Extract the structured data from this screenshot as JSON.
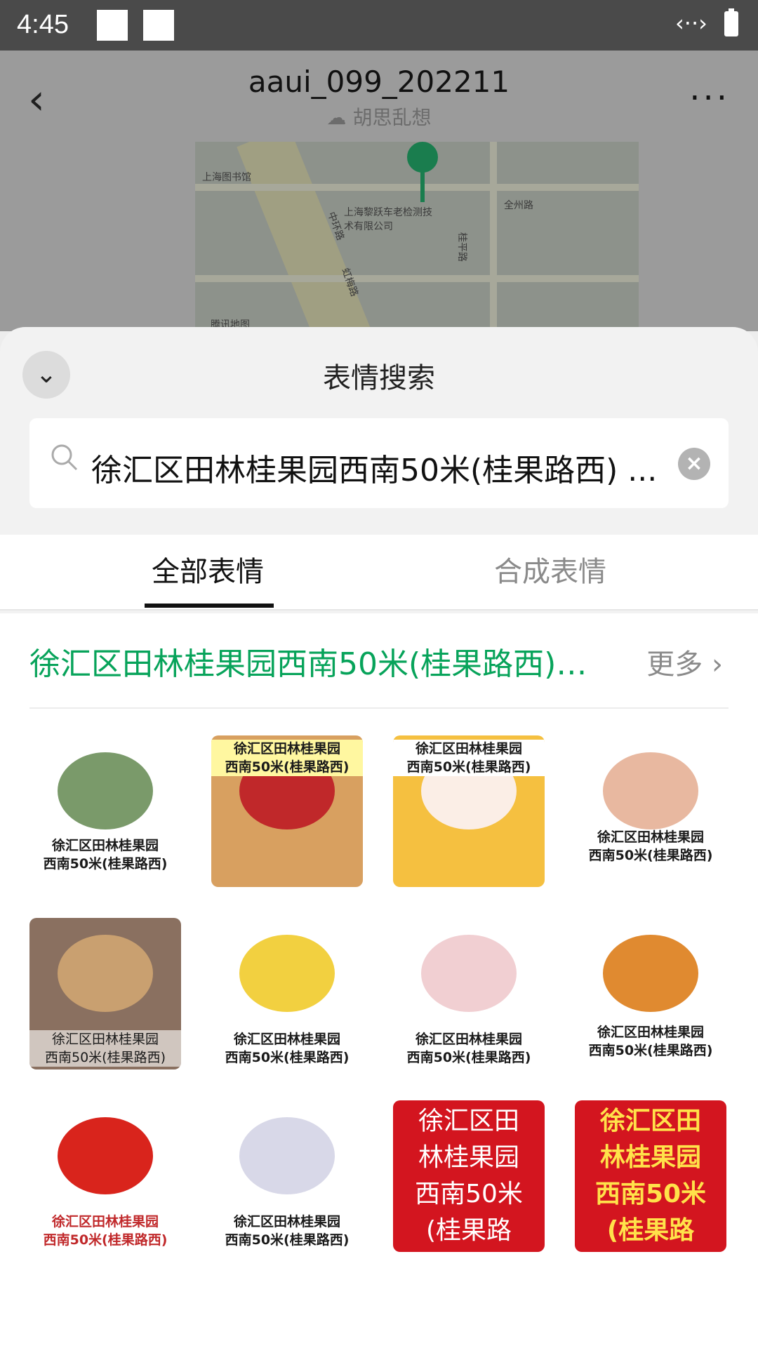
{
  "status_bar": {
    "time": "4:45"
  },
  "chat": {
    "title": "aaui_099_202211",
    "subtitle": "胡思乱想",
    "map_labels": [
      "上海图书馆",
      "上海黎跃车老检测技术有限公司",
      "腾讯地图",
      "中环路",
      "虹梅路",
      "桂平路",
      "全州路"
    ]
  },
  "sheet": {
    "title": "表情搜索",
    "search_query": "徐汇区田林桂果园西南50米(桂果路西) ...",
    "tabs": [
      {
        "label": "全部表情",
        "active": true
      },
      {
        "label": "合成表情",
        "active": false
      }
    ]
  },
  "results": {
    "heading": "徐汇区田林桂果园西南50米(桂果路西) ...",
    "more_label": "更多",
    "stickers": [
      {
        "caption": "徐汇区田林桂果园\n西南50米(桂果路西)",
        "style": "white-bg"
      },
      {
        "caption": "徐汇区田林桂果园\n西南50米(桂果路西)",
        "style": "workers"
      },
      {
        "caption": "徐汇区田林桂果园\n西南50米(桂果路西)",
        "style": "hamsters"
      },
      {
        "caption": "徐汇区田林桂果园\n西南50米(桂果路西)",
        "style": "propaganda"
      },
      {
        "caption": "徐汇区田林桂果园\n西南50米(桂果路西)",
        "style": "bricks"
      },
      {
        "caption": "徐汇区田林桂果园\n西南50米(桂果路西)",
        "style": "lady"
      },
      {
        "caption": "徐汇区田林桂果园\n西南50米(桂果路西)",
        "style": "hoe-girl"
      },
      {
        "caption": "徐汇区田林桂果园\n西南50米(桂果路西)",
        "style": "kimono-girl"
      },
      {
        "caption": "徐汇区田林桂果园\n西南50米(桂果路西)",
        "style": "flag"
      },
      {
        "caption": "徐汇区田林桂果园\n西南50米(桂果路西)",
        "style": "grandma"
      },
      {
        "caption": "徐汇区田\n林桂果园\n西南50米\n(桂果路",
        "style": "red-plain"
      },
      {
        "caption": "徐汇区田\n林桂果园\n西南50米\n(桂果路",
        "style": "red-gold"
      }
    ]
  },
  "colors": {
    "accent": "#07a35a",
    "statusbar": "#4a4a4a",
    "sheet_bg": "#f2f2f2"
  }
}
